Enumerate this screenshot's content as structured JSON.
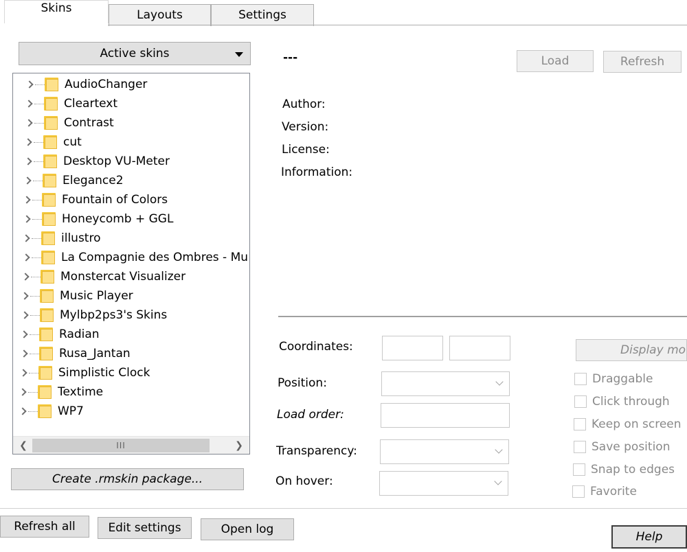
{
  "tabs": [
    {
      "label": "Skins",
      "active": true
    },
    {
      "label": "Layouts",
      "active": false
    },
    {
      "label": "Settings",
      "active": false
    }
  ],
  "skins_panel": {
    "dropdown_value": "Active skins",
    "items": [
      "AudioChanger",
      "Cleartext",
      "Contrast",
      "cut",
      "Desktop VU-Meter",
      "Elegance2",
      "Fountain of Colors",
      "Honeycomb + GGL",
      "illustro",
      "La Compagnie des Ombres - Mu",
      "Monstercat Visualizer",
      "Music Player",
      "Mylbp2ps3's Skins",
      "Radian",
      "Rusa_Jantan",
      "Simplistic Clock",
      "Textime",
      "WP7"
    ],
    "scroll_thumb_glyph": "III",
    "create_button": "Create .rmskin package..."
  },
  "details": {
    "name": "---",
    "load_button": "Load",
    "refresh_button": "Refresh",
    "author_label": "Author:",
    "version_label": "Version:",
    "license_label": "License:",
    "information_label": "Information:"
  },
  "settings": {
    "coordinates_label": "Coordinates:",
    "position_label": "Position:",
    "load_order_label": "Load order:",
    "transparency_label": "Transparency:",
    "on_hover_label": "On hover:",
    "display_button": "Display mo",
    "checks": [
      "Draggable",
      "Click through",
      "Keep on screen",
      "Save position",
      "Snap to edges",
      "Favorite"
    ]
  },
  "footer": {
    "refresh_all": "Refresh all",
    "edit_settings": "Edit settings",
    "open_log": "Open log",
    "help": "Help"
  }
}
